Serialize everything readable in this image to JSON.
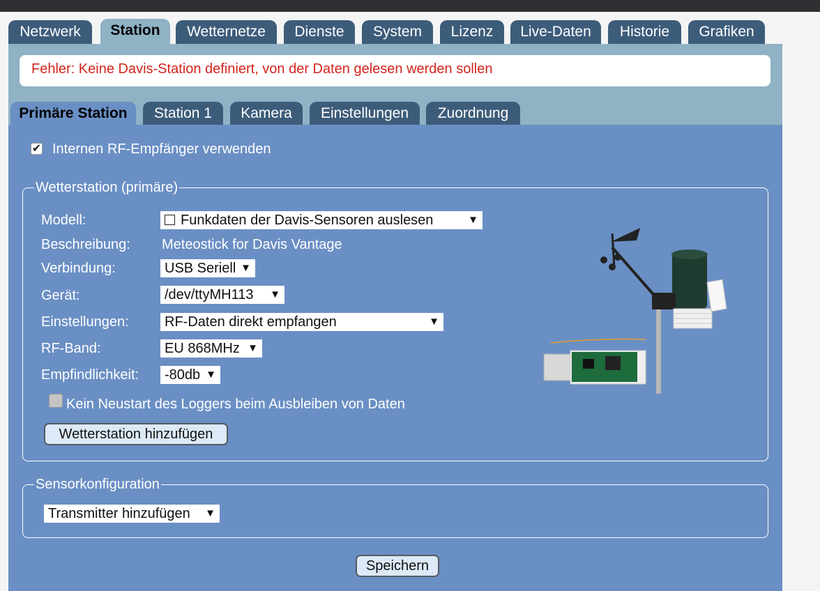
{
  "main_tabs": [
    {
      "label": "Netzwerk",
      "active": false
    },
    {
      "label": "Station",
      "active": true
    },
    {
      "label": "Wetternetze",
      "active": false
    },
    {
      "label": "Dienste",
      "active": false
    },
    {
      "label": "System",
      "active": false
    },
    {
      "label": "Lizenz",
      "active": false
    },
    {
      "label": "Live-Daten",
      "active": false
    },
    {
      "label": "Historie",
      "active": false
    },
    {
      "label": "Grafiken",
      "active": false
    }
  ],
  "error_message": "Fehler: Keine Davis-Station definiert, von der Daten gelesen werden sollen",
  "sub_tabs": [
    {
      "label": "Primäre Station",
      "active": true
    },
    {
      "label": "Station 1",
      "active": false
    },
    {
      "label": "Kamera",
      "active": false
    },
    {
      "label": "Einstellungen",
      "active": false
    },
    {
      "label": "Zuordnung",
      "active": false
    }
  ],
  "internal_rf": {
    "label": "Internen RF-Empfänger verwenden",
    "checked": true
  },
  "weather_station": {
    "legend": "Wetterstation (primäre)",
    "model": {
      "label": "Modell:",
      "value": "Funkdaten der Davis-Sensoren auslesen"
    },
    "description": {
      "label": "Beschreibung:",
      "value": "Meteostick for Davis Vantage"
    },
    "connection": {
      "label": "Verbindung:",
      "value": "USB Seriell"
    },
    "device": {
      "label": "Gerät:",
      "value": "/dev/ttyMH113"
    },
    "settings": {
      "label": "Einstellungen:",
      "value": "RF-Daten direkt empfangen"
    },
    "rf_band": {
      "label": "RF-Band:",
      "value": "EU 868MHz"
    },
    "sensitivity": {
      "label": "Empfindlichkeit:",
      "value": "-80db"
    },
    "no_restart": {
      "label": "Kein Neustart des Loggers beim Ausbleiben von Daten",
      "checked": false
    },
    "add_button": "Wetterstation hinzufügen"
  },
  "sensor_config": {
    "legend": "Sensorkonfiguration",
    "transmitter_select": "Transmitter hinzufügen"
  },
  "save_button": "Speichern",
  "colors": {
    "main_panel": "#6a8fc4",
    "upper_panel": "#8fb2c4",
    "tab_inactive": "#3d5c7a",
    "error_text": "#d4241d"
  }
}
